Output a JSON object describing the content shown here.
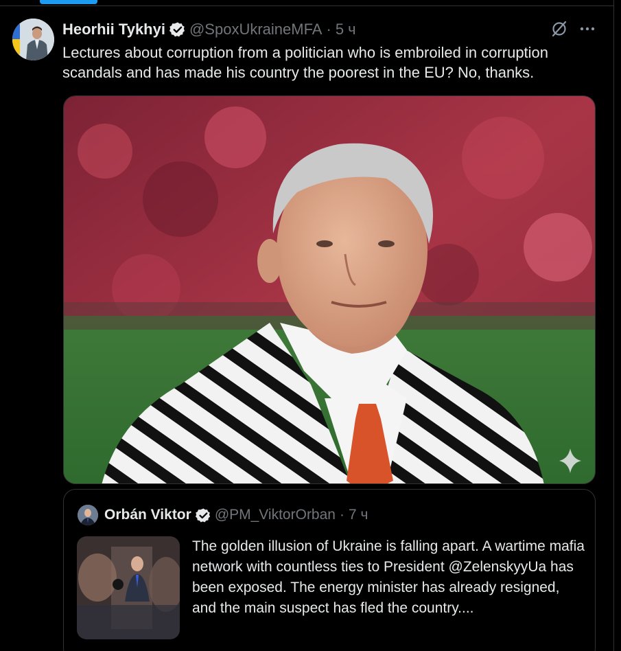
{
  "tweet": {
    "author_name": "Heorhii Tykhyi",
    "handle": "@SpoxUkraineMFA",
    "separator": "·",
    "time": "5 ч",
    "text": "Lectures about corruption from a politician who is embroiled in corruption scandals and has made his country the poorest in the EU? No, thanks.",
    "icons": {
      "verified": "verified-badge-icon",
      "grok": "grok-icon",
      "more": "more-icon",
      "media_overlay": "sparkle-icon"
    }
  },
  "quoted_tweet": {
    "author_name": "Orbán Viktor",
    "handle": "@PM_ViktorOrban",
    "separator": "·",
    "time": "7 ч",
    "text": "The golden illusion of Ukraine is falling apart. A wartime mafia network with countless ties to President @ZelenskyyUa has been exposed. The energy minister has already resigned, and the main suspect has fled the country...."
  },
  "colors": {
    "background": "#000000",
    "text": "#e7e9ea",
    "muted": "#71767b",
    "border": "#2f3336",
    "accent": "#1d9bf0"
  }
}
